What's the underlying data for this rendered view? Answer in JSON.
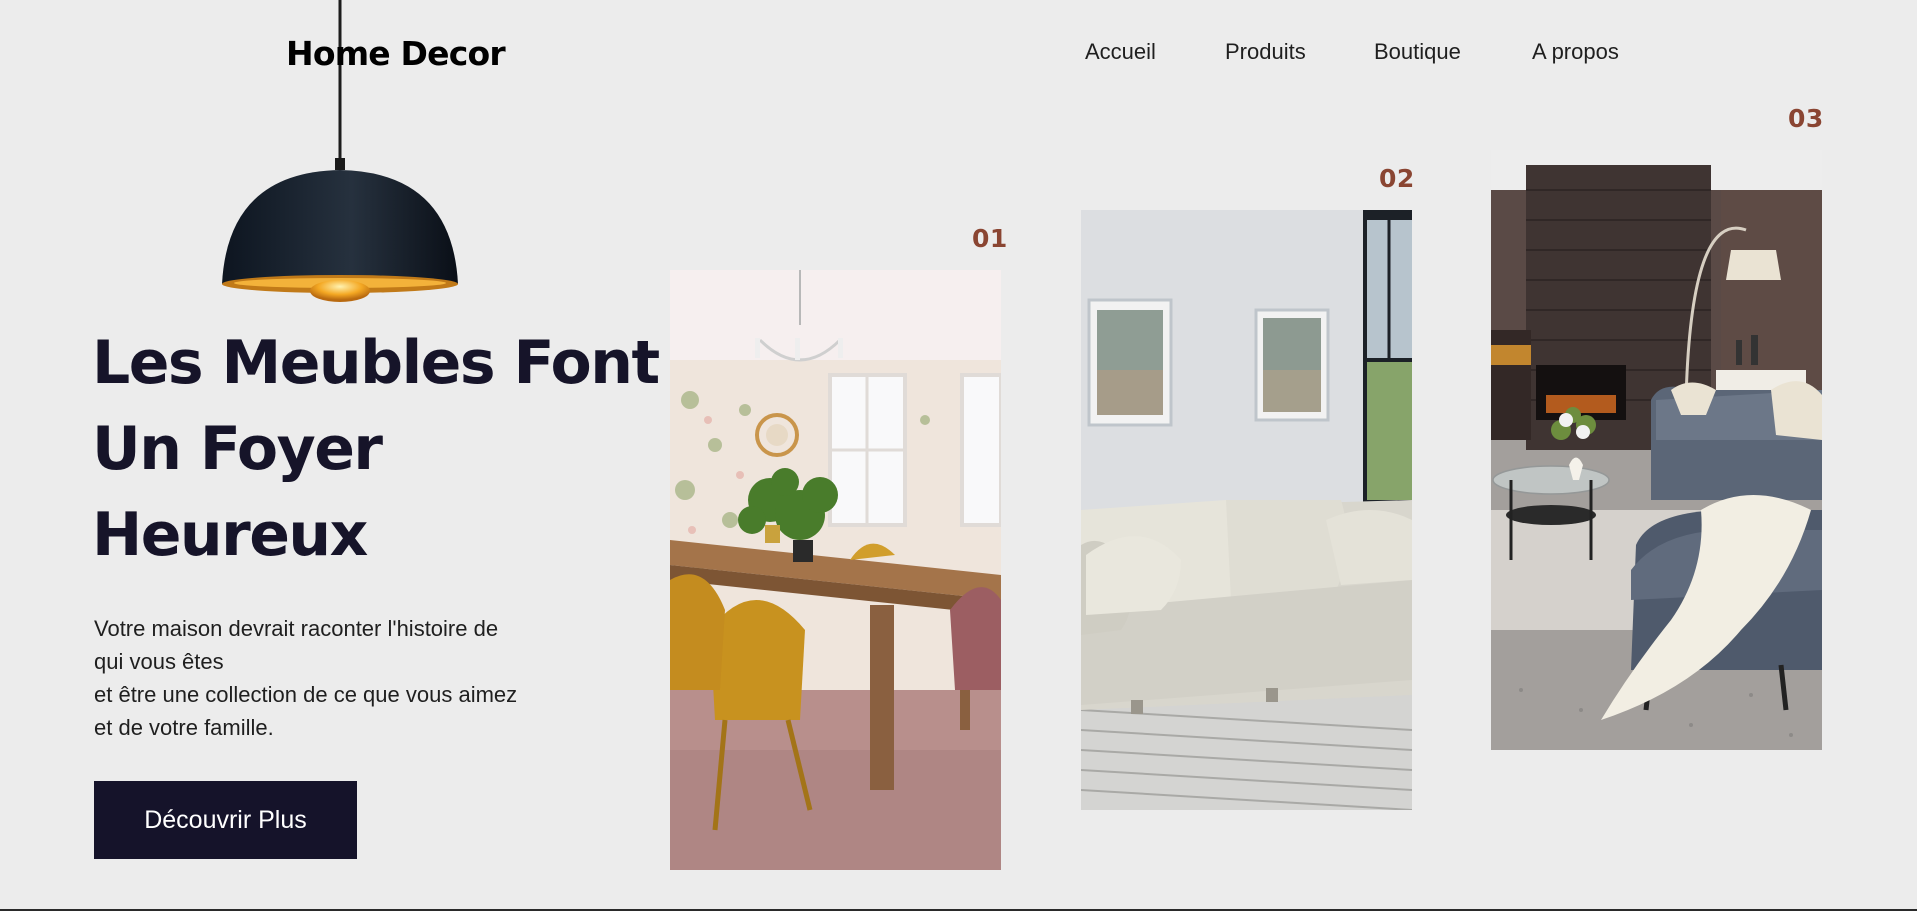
{
  "brand": {
    "name": "Home Decor"
  },
  "nav": {
    "items": [
      {
        "label": "Accueil"
      },
      {
        "label": "Produits"
      },
      {
        "label": "Boutique"
      },
      {
        "label": "A propos"
      }
    ]
  },
  "hero": {
    "title_lines": [
      "Les Meubles Font",
      "Un Foyer",
      "Heureux"
    ],
    "description_lines": [
      "Votre maison devrait raconter l'histoire de",
      "qui vous êtes",
      "et être une collection de ce que vous aimez",
      "et de votre famille."
    ],
    "cta_label": "Découvrir Plus"
  },
  "gallery": {
    "cards": [
      {
        "number": "01",
        "image": "dining-room-photo"
      },
      {
        "number": "02",
        "image": "sofa-living-room-photo"
      },
      {
        "number": "03",
        "image": "fireplace-lounge-photo"
      }
    ]
  },
  "colors": {
    "background": "#ececec",
    "primary_dark": "#15132a",
    "accent_number": "#8a4532"
  }
}
